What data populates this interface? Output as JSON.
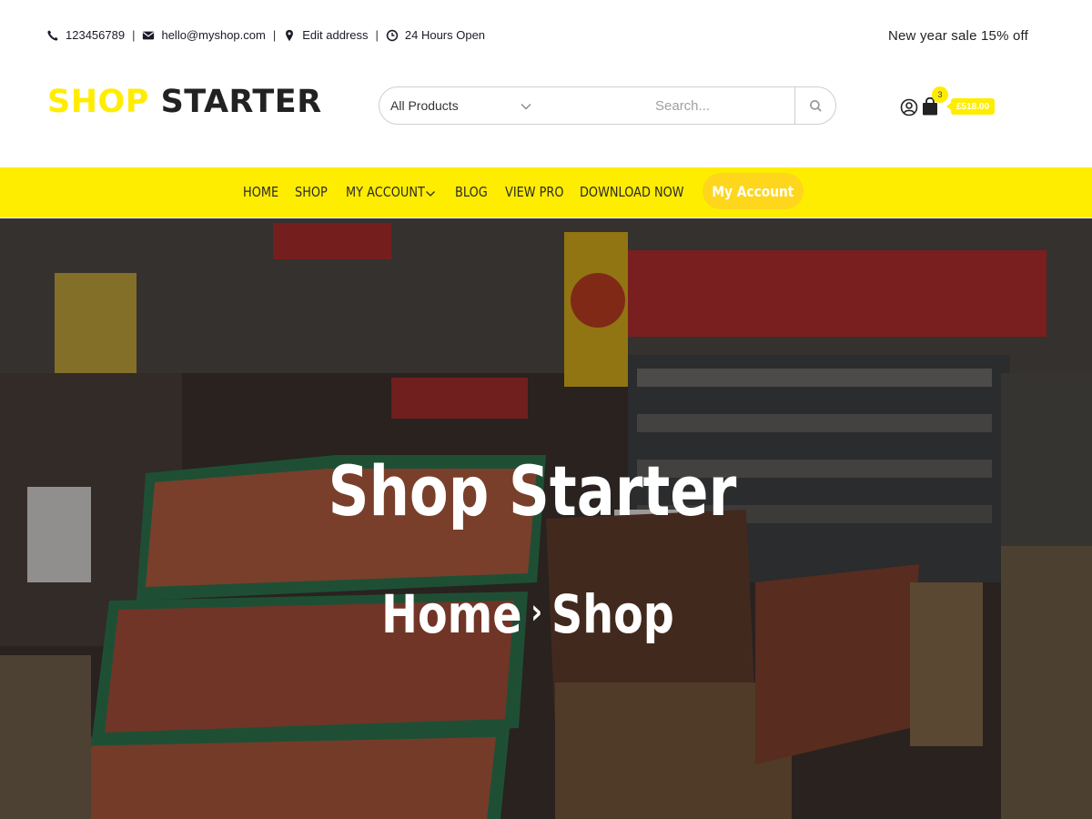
{
  "topbar": {
    "phone": "123456789",
    "email": "hello@myshop.com",
    "address": "Edit address",
    "hours": "24 Hours Open",
    "separator": "|",
    "promo": "New year sale 15% off"
  },
  "logo": {
    "part1": "SHOP",
    "part2": "STARTER"
  },
  "search": {
    "category": "All Products",
    "placeholder": "Search..."
  },
  "cart": {
    "count": "3",
    "total": "£518.00"
  },
  "nav": {
    "items": [
      "HOME",
      "SHOP",
      "MY ACCOUNT",
      "BLOG",
      "VIEW PRO",
      "DOWNLOAD NOW"
    ],
    "account_button": "My Account"
  },
  "hero": {
    "title": "Shop Starter",
    "breadcrumb_home": "Home",
    "breadcrumb_sep": "›",
    "breadcrumb_current": "Shop"
  },
  "colors": {
    "accent": "#ffed00",
    "button": "#fed61c",
    "text_dark": "#222222"
  },
  "icons": [
    "phone-icon",
    "envelope-icon",
    "map-marker-icon",
    "clock-icon",
    "chevron-down-icon",
    "search-icon",
    "user-icon",
    "shopping-bag-icon"
  ]
}
